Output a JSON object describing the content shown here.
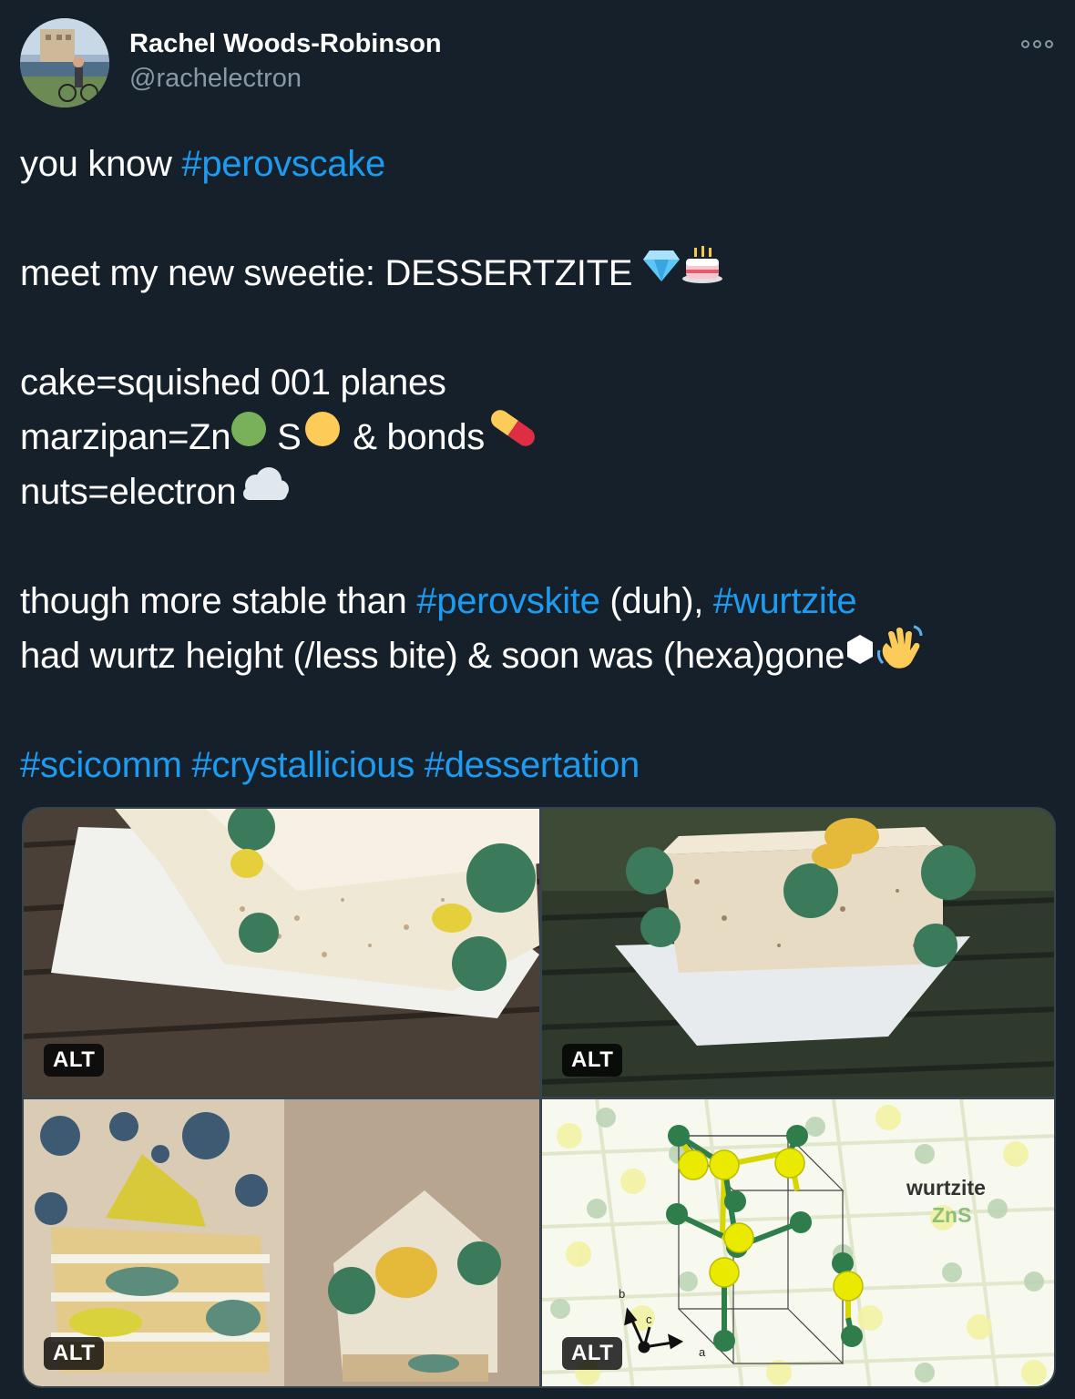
{
  "author": {
    "name": "Rachel Woods-Robinson",
    "handle": "@rachelectron"
  },
  "tweet": {
    "l1_pre": "you know ",
    "l1_tag": "#perovscake",
    "l2_text": "meet my new sweetie: DESSERTZITE ",
    "l3_text": "cake=squished 001 planes",
    "l4_a": "marzipan=Zn",
    "l4_b": " S",
    "l4_c": " & bonds",
    "l5_text": "nuts=electron",
    "l6_pre": "though more stable than ",
    "l6_tag1": "#perovskite",
    "l6_mid": " (duh), ",
    "l6_tag2": "#wurtzite",
    "l7_text": "had wurtz height (/less bite) & soon was (hexa)gone",
    "tags": [
      "#scicomm",
      "#crystallicious",
      "#dessertation"
    ]
  },
  "emojis": [
    "gem-stone",
    "birthday-cake",
    "green-circle",
    "yellow-circle",
    "pill",
    "cloud",
    "white-hexagon",
    "waving-hand"
  ],
  "media": {
    "alt_label": "ALT",
    "diagram_title": "wurtzite",
    "diagram_formula": "ZnS",
    "axis_a": "a",
    "axis_b": "b",
    "axis_c": "c"
  },
  "colors": {
    "background": "#15202b",
    "hashtag": "#1d9bf0",
    "secondary_text": "#8899a6"
  }
}
